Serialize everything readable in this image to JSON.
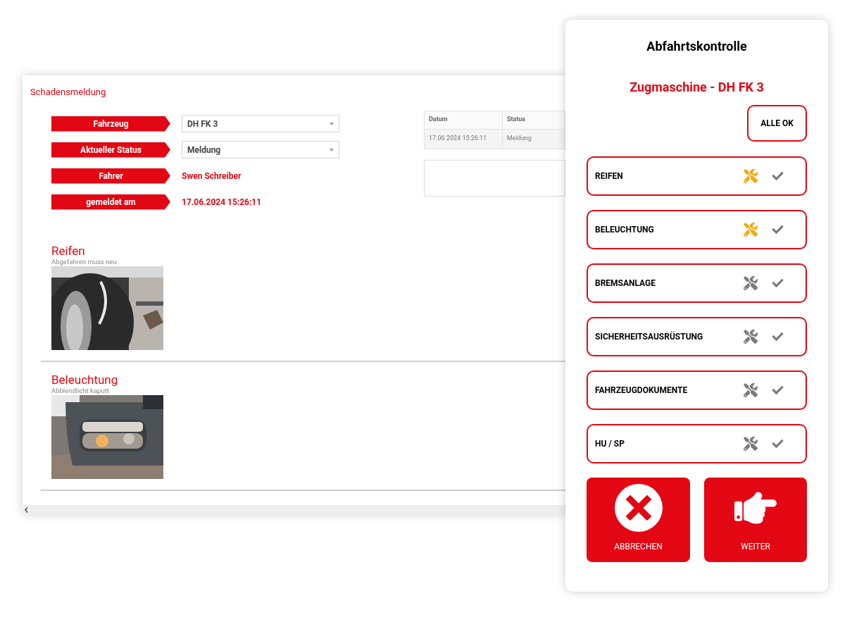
{
  "report": {
    "title": "Schadensmeldung",
    "fields": [
      {
        "label": "Fahrzeug",
        "kind": "select",
        "value": "DH FK 3"
      },
      {
        "label": "Aktueller Status",
        "kind": "select",
        "value": "Meldung"
      },
      {
        "label": "Fahrer",
        "kind": "text",
        "value": "Swen Schreiber"
      },
      {
        "label": "gemeldet am",
        "kind": "text",
        "value": "17.06.2024 15:26:11"
      }
    ],
    "table": {
      "columns": [
        "Datum",
        "Status"
      ],
      "rows": [
        [
          "17.06.2024 15:26:11",
          "Meldung"
        ]
      ]
    },
    "damages": [
      {
        "title": "Reifen",
        "note": "Abgefahren muss neu",
        "kind": "picture"
      },
      {
        "title": "Beleuchtung",
        "note": "Abblendlicht kaputt",
        "kind": "picture"
      }
    ]
  },
  "checklist": {
    "title": "Abfahrtskontrolle",
    "vehicle": "Zugmaschine - DH FK 3",
    "all_ok": "ALLE OK",
    "items": [
      {
        "label": "REIFEN",
        "flagged": true
      },
      {
        "label": "BELEUCHTUNG",
        "flagged": true
      },
      {
        "label": "BREMSANLAGE",
        "flagged": false
      },
      {
        "label": "SICHERHEITSAUSRÜSTUNG",
        "flagged": false
      },
      {
        "label": "FAHRZEUGDOKUMENTE",
        "flagged": false
      },
      {
        "label": "HU / SP",
        "flagged": false
      }
    ],
    "buttons": [
      {
        "label": "ABBRECHEN",
        "kind": "cancel"
      },
      {
        "label": "WEITER",
        "kind": "next"
      }
    ]
  }
}
